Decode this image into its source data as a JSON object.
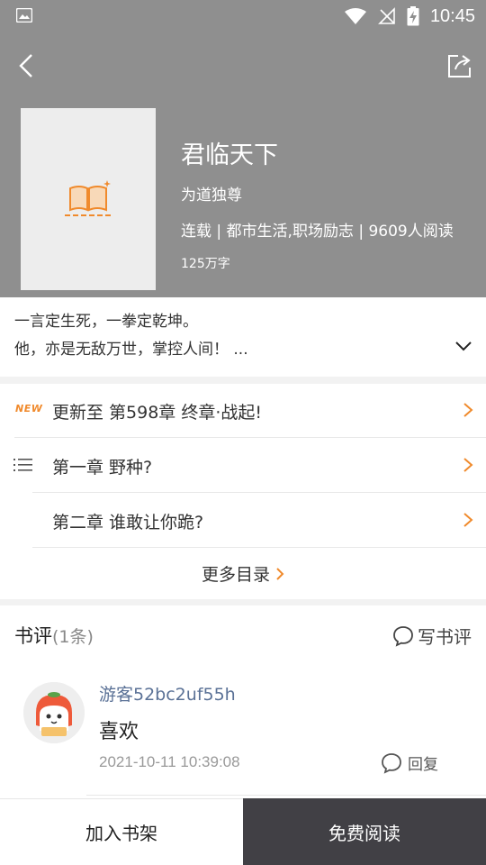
{
  "status_bar": {
    "time": "10:45"
  },
  "book": {
    "title": "君临天下",
    "author": "为道独尊",
    "meta": "连载 | 都市生活,职场励志 | 9609人阅读",
    "words": "125万字"
  },
  "intro": {
    "line1": "一言定生死，一拳定乾坤。",
    "line2": "他，亦是无敌万世，掌控人间！ ..."
  },
  "chapters": {
    "new_badge": "NEW",
    "latest": "更新至 第598章 终章·战起!",
    "first": "第一章 野种?",
    "second": "第二章  谁敢让你跪?",
    "more_label": "更多目录"
  },
  "reviews": {
    "title": "书评",
    "count": "(1条)",
    "write_label": "写书评",
    "items": [
      {
        "user": "游客52bc2uf55h",
        "content": "喜欢",
        "time": "2021-10-11 10:39:08",
        "reply_label": "回复"
      }
    ]
  },
  "bottom_bar": {
    "add_shelf": "加入书架",
    "free_read": "免费阅读"
  },
  "colors": {
    "header_bg": "#8f8f8f",
    "accent": "#f08a2c",
    "read_button_bg": "#414045",
    "username": "#5a7196"
  }
}
